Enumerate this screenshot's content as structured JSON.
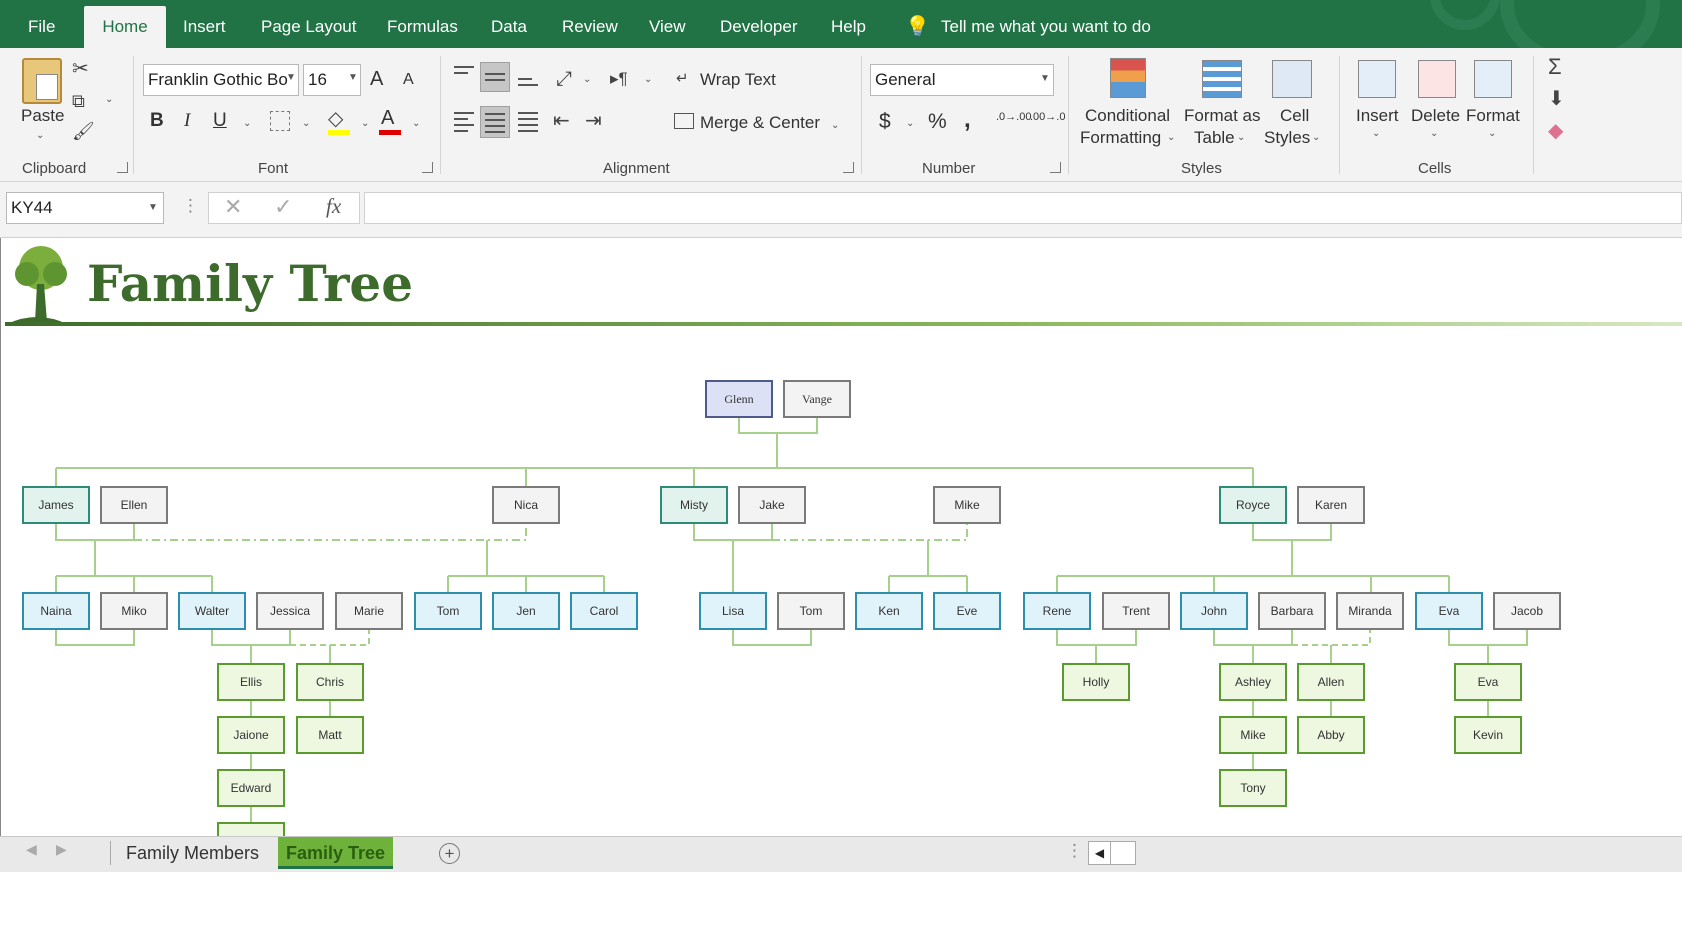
{
  "ribbon_tabs": [
    "File",
    "Home",
    "Insert",
    "Page Layout",
    "Formulas",
    "Data",
    "Review",
    "View",
    "Developer",
    "Help"
  ],
  "tell_me": "Tell me what you want to do",
  "clipboard": {
    "paste": "Paste",
    "label": "Clipboard"
  },
  "font": {
    "name": "Franklin Gothic Bo",
    "size": "16",
    "bold": "B",
    "italic": "I",
    "underline": "U",
    "grow": "A",
    "shrink": "A",
    "color": "A",
    "label": "Font"
  },
  "alignment": {
    "wrap": "Wrap Text",
    "merge": "Merge & Center",
    "label": "Alignment"
  },
  "number": {
    "format": "General",
    "currency": "$",
    "percent": "%",
    "comma": ",",
    "inc_dec": ".0→.00",
    "dec_dec": ".00→.0",
    "label": "Number"
  },
  "styles": {
    "conditional_1": "Conditional",
    "conditional_2": "Formatting",
    "table_1": "Format as",
    "table_2": "Table",
    "cell_1": "Cell",
    "cell_2": "Styles",
    "label": "Styles"
  },
  "cells": {
    "insert": "Insert",
    "delete": "Delete",
    "format": "Format",
    "label": "Cells"
  },
  "formula_bar": {
    "name_box": "KY44",
    "fx": "fx",
    "value": ""
  },
  "sheet": {
    "title": "Family Tree"
  },
  "tree": {
    "glenn": "Glenn",
    "vange": "Vange",
    "james": "James",
    "ellen": "Ellen",
    "nica": "Nica",
    "misty": "Misty",
    "jake": "Jake",
    "mike1": "Mike",
    "royce": "Royce",
    "karen": "Karen",
    "naina": "Naina",
    "miko": "Miko",
    "walter": "Walter",
    "jessica": "Jessica",
    "marie": "Marie",
    "tom1": "Tom",
    "jen": "Jen",
    "carol": "Carol",
    "lisa": "Lisa",
    "tom2": "Tom",
    "ken": "Ken",
    "eve": "Eve",
    "rene": "Rene",
    "trent": "Trent",
    "john": "John",
    "barbara": "Barbara",
    "miranda": "Miranda",
    "eva1": "Eva",
    "jacob": "Jacob",
    "ellis": "Ellis",
    "chris": "Chris",
    "jaione": "Jaione",
    "matt": "Matt",
    "edward": "Edward",
    "holly": "Holly",
    "ashley": "Ashley",
    "allen": "Allen",
    "mike2": "Mike",
    "abby": "Abby",
    "tony": "Tony",
    "eva2": "Eva",
    "kevin": "Kevin"
  },
  "sheet_tabs": [
    "Family Members",
    "Family Tree"
  ],
  "colors": {
    "excel_green": "#217346",
    "title_green": "#3d6b2b",
    "connector": "#a8d08d"
  }
}
